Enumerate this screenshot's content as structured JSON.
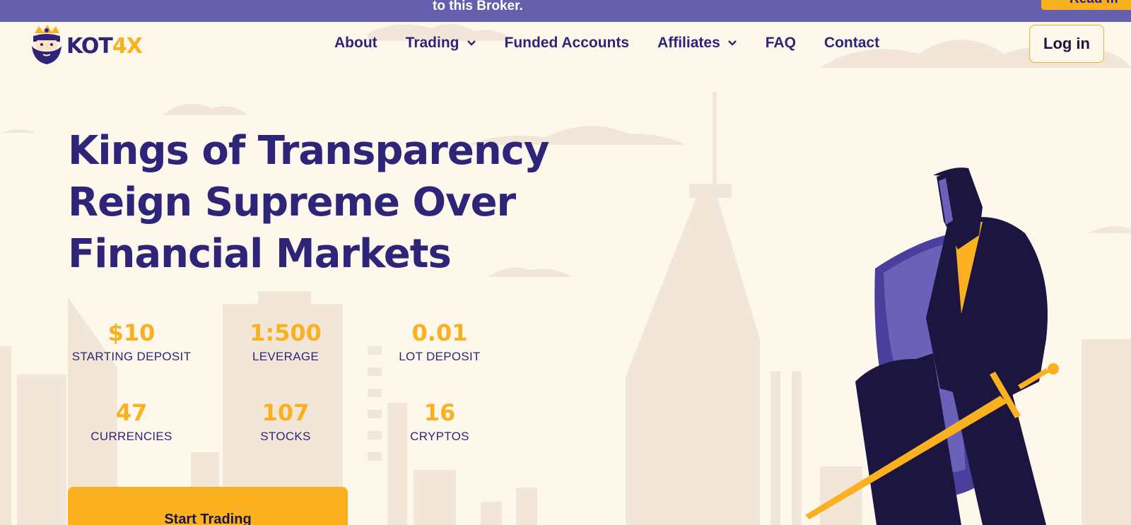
{
  "banner": {
    "text": "to this Broker.",
    "button_label": "Read m"
  },
  "brand": {
    "name_part1": "KOT",
    "name_part2": "4X",
    "logo_icon": "bearded-king-icon"
  },
  "nav": {
    "items": [
      {
        "label": "About",
        "has_dropdown": false
      },
      {
        "label": "Trading",
        "has_dropdown": true
      },
      {
        "label": "Funded Accounts",
        "has_dropdown": false
      },
      {
        "label": "Affiliates",
        "has_dropdown": true
      },
      {
        "label": "FAQ",
        "has_dropdown": false
      },
      {
        "label": "Contact",
        "has_dropdown": false
      }
    ],
    "login_label": "Log in"
  },
  "hero": {
    "title_lines": [
      "Kings of Transparency",
      "Reign Supreme Over",
      "Financial Markets"
    ],
    "stats": [
      {
        "value": "$10",
        "label": "STARTING DEPOSIT"
      },
      {
        "value": "1:500",
        "label": "LEVERAGE"
      },
      {
        "value": "0.01",
        "label": "LOT DEPOSIT"
      },
      {
        "value": "47",
        "label": "CURRENCIES"
      },
      {
        "value": "107",
        "label": "STOCKS"
      },
      {
        "value": "16",
        "label": "CRYPTOS"
      }
    ],
    "cta_label": "Start Trading",
    "illustration": "knight-businessman-with-shield-and-sword"
  },
  "colors": {
    "brand_purple": "#2e2579",
    "accent_gold": "#fbb01f",
    "banner_purple": "#6560ad",
    "background": "#fdf7ec"
  }
}
